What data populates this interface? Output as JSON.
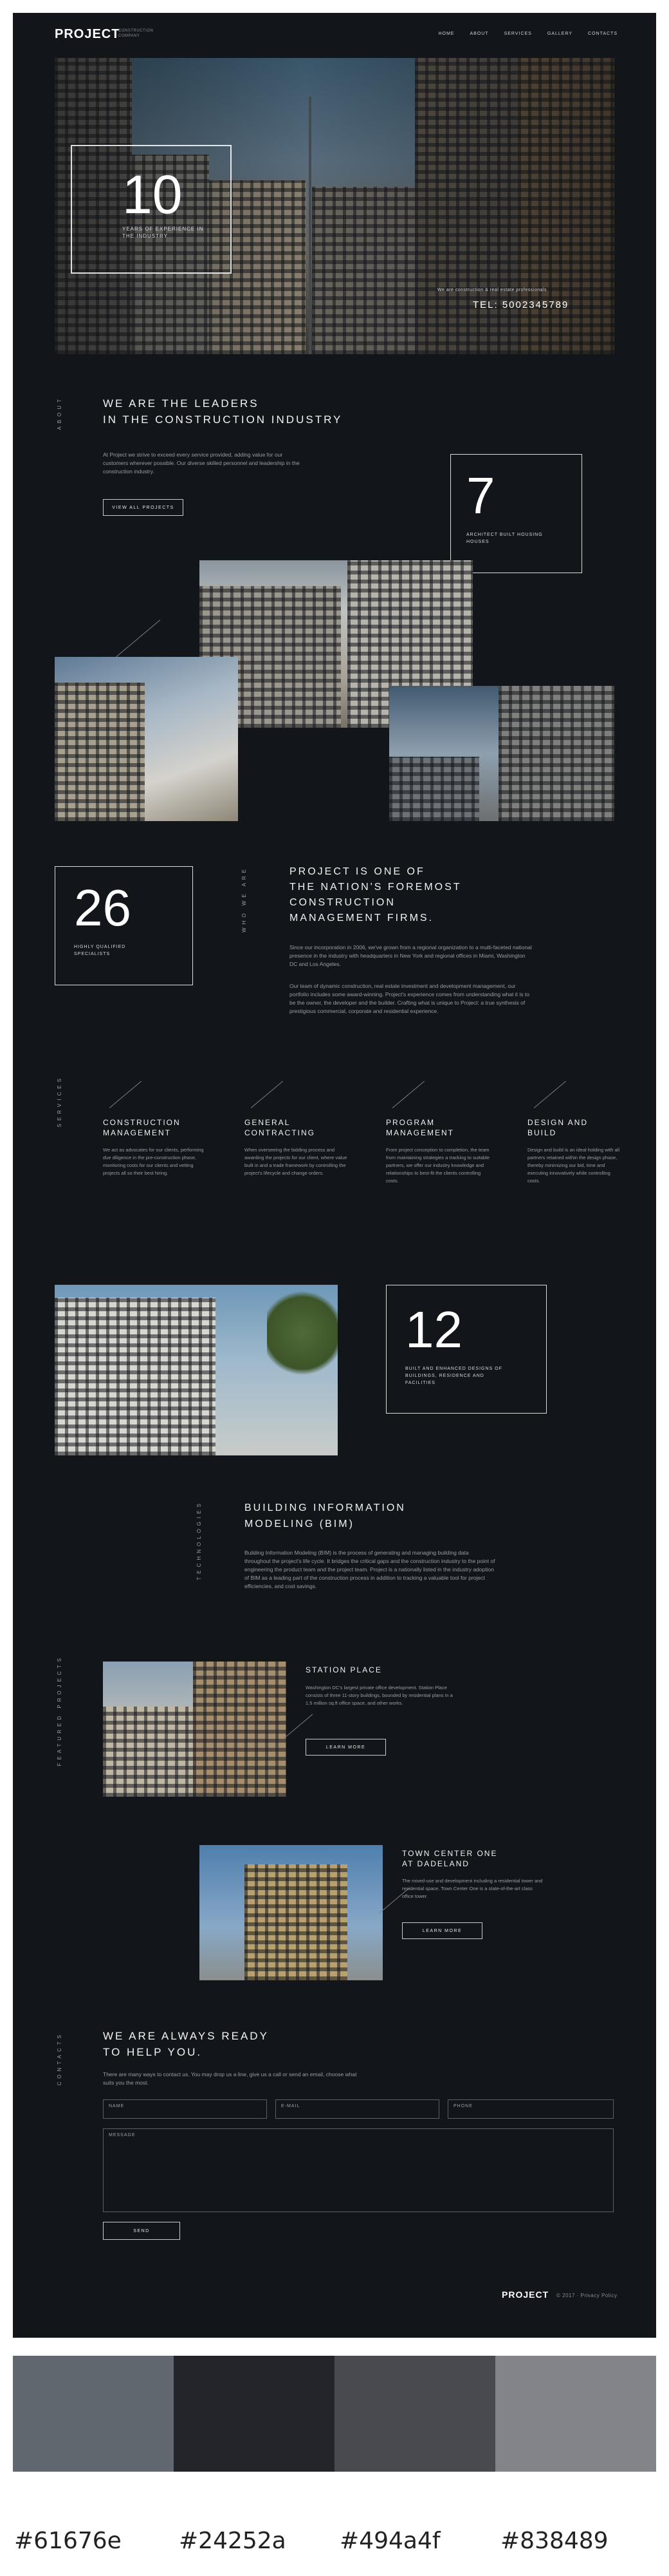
{
  "header": {
    "logo": "PROJECT",
    "logo_sub": "CONSTRUCTION COMPANY",
    "nav": [
      "HOME",
      "ABOUT",
      "SERVICES",
      "GALLERY",
      "CONTACTS"
    ]
  },
  "hero": {
    "stat_number": "10",
    "stat_label": "YEARS OF EXPERIENCE IN THE INDUSTRY",
    "right_caption": "We are construction & real estate professionals",
    "tel": "TEL: 5002345789"
  },
  "leaders": {
    "vertical_label": "ABOUT",
    "title_line1": "WE ARE THE LEADERS",
    "title_line2": "IN THE CONSTRUCTION INDUSTRY",
    "body": "At Project we strive to exceed every service provided, adding value for our customers wherever possible. Our diverse skilled personnel and leadership in the construction industry.",
    "button": "VIEW ALL PROJECTS",
    "stat_number": "7",
    "stat_label": "ARCHITECT BUILT HOUSING HOUSES"
  },
  "foremost": {
    "stat_number": "26",
    "stat_label": "HIGHLY QUALIFIED SPECIALISTS",
    "vertical_label": "WHO WE ARE",
    "title_line1": "PROJECT IS ONE OF",
    "title_line2": "THE NATION'S FOREMOST",
    "title_line3": "CONSTRUCTION",
    "title_line4": "MANAGEMENT FIRMS.",
    "body1": "Since our incorporation in 2006, we've grown from a regional organization to a multi-faceted national presence in the industry with headquarters in New York and regional offices in Miami, Washington DC and Los Angeles.",
    "body2": "Our team of dynamic construction, real estate investment and development management, our portfolio includes some award-winning. Project's experience comes from understanding what it is to be the owner, the developer and the builder. Crafting what is unique to Project: a true synthesis of prestigious commercial, corporate and residential experience."
  },
  "services": {
    "vertical_label": "SERVICES",
    "items": [
      {
        "title_line1": "CONSTRUCTION",
        "title_line2": "MANAGEMENT",
        "body": "We act as advocates for our clients, performing due diligence in the pre-construction phase, monitoring costs for our clients and vetting projects all so their best hiring."
      },
      {
        "title_line1": "GENERAL",
        "title_line2": "CONTRACTING",
        "body": "When overseeing the bidding process and awarding the projects for our client, where value built in and a trade framework by controlling the project's lifecycle and change orders."
      },
      {
        "title_line1": "PROGRAM",
        "title_line2": "MANAGEMENT",
        "body": "From project conception to completion, the team from maintaining strategies a tracking to suitable partners, we offer our industry knowledge and relationships to best-fit the clients controlling costs."
      },
      {
        "title_line1": "DESIGN AND",
        "title_line2": "BUILD",
        "body": "Design and build is an ideal holding with all partners retained within the design phase, thereby minimizing our bid, time and executing innovatively while controlling costs."
      }
    ]
  },
  "bim_stat": {
    "stat_number": "12",
    "stat_label": "BUILT AND ENHANCED DESIGNS OF BUILDINGS, RESIDENCE AND FACILITIES"
  },
  "bim": {
    "vertical_label": "TECHNOLOGIES",
    "title_line1": "BUILDING INFORMATION",
    "title_line2": "MODELING (BIM)",
    "body": "Building Information Modeling (BIM) is the process of generating and managing building data throughout the project's life cycle. It bridges the critical gaps and the construction industry to the point of engineering the product team and the project team. Project is a nationally listed in the industry adoption of BIM as a leading part of the construction process in addition to tracking a valuable tool for project efficiencies, and cost savings."
  },
  "projects": {
    "vertical_label": "FEATURED PROJECTS",
    "station": {
      "title": "STATION PLACE",
      "body": "Washington DC's largest private office development. Station Place consists of three 11-story buildings, bounded by residential plans in a 1.5 million sq.ft office space, and other works.",
      "button": "LEARN MORE"
    },
    "town": {
      "title_line1": "TOWN CENTER ONE",
      "title_line2": "AT DADELAND",
      "body": "The mixed-use and development including a residential tower and residential space. Town Center One is a state-of-the-art class office tower.",
      "button": "LEARN MORE"
    }
  },
  "contact": {
    "vertical_label": "CONTACTS",
    "title_line1": "WE ARE ALWAYS READY",
    "title_line2": "TO HELP YOU.",
    "body": "There are many ways to contact us. You may drop us a line, give us a call or send an email, choose what suits you the most.",
    "name_placeholder": "NAME",
    "email_placeholder": "E-MAIL",
    "phone_placeholder": "PHONE",
    "message_placeholder": "MESSAGE",
    "send_button": "SEND"
  },
  "footer": {
    "logo": "PROJECT",
    "copy": "© 2017 · Privacy Policy"
  },
  "palette": {
    "colors": [
      "#61676e",
      "#24252a",
      "#494a4f",
      "#838489"
    ],
    "labels": [
      "#61676e",
      "#24252a",
      "#494a4f",
      "#838489"
    ]
  }
}
